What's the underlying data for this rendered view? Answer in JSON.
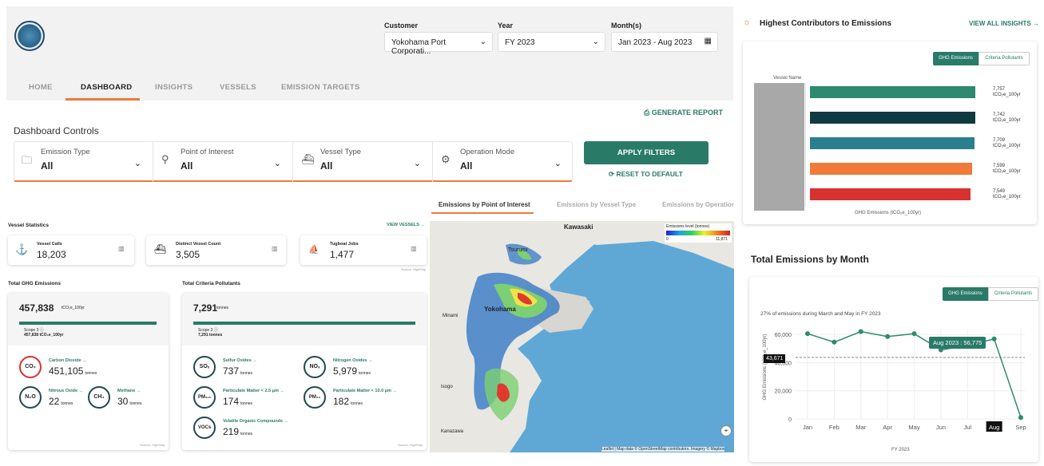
{
  "logo_text": "",
  "filters": {
    "customer_label": "Customer",
    "customer_value": "Yokohama Port Corporati...",
    "year_label": "Year",
    "year_value": "FY 2023",
    "month_label": "Month(s)",
    "month_value": "Jan 2023 - Aug 2023"
  },
  "nav": [
    "HOME",
    "DASHBOARD",
    "INSIGHTS",
    "VESSELS",
    "EMISSION TARGETS"
  ],
  "generate_report": "GENERATE REPORT",
  "dashboard_controls": "Dashboard Controls",
  "controls": [
    {
      "title": "Emission Type",
      "value": "All"
    },
    {
      "title": "Point of Interest",
      "value": "All"
    },
    {
      "title": "Vessel Type",
      "value": "All"
    },
    {
      "title": "Operation Mode",
      "value": "All"
    }
  ],
  "apply_filters": "APPLY FILTERS",
  "reset": "RESET TO DEFAULT",
  "map_tabs": [
    "Emissions by Point of Interest",
    "Emissions by Vessel Type",
    "Emissions by Operation"
  ],
  "map": {
    "legend_title": "Emissions level (tonnes)",
    "legend_min": "0",
    "legend_max": "11,871",
    "places": [
      "Tsurumi",
      "Kawasaki",
      "Yokohama",
      "Minami",
      "Isogo",
      "Kanazawa"
    ],
    "attribution": "Leaflet | Map data © OpenStreetMap contributors, Imagery © Mapbox"
  },
  "vessel_stats": {
    "title": "Vessel Statistics",
    "view_link": "VIEW VESSELS →",
    "items": [
      {
        "label": "Vessel Calls",
        "value": "18,203"
      },
      {
        "label": "Distinct Vessel Count",
        "value": "3,505"
      },
      {
        "label": "Tugboat Jobs",
        "value": "1,477"
      }
    ],
    "source": "Source: HighShip"
  },
  "ghg": {
    "title": "Total GHG Emissions",
    "total": "457,838",
    "unit": "tCO₂e_100yr",
    "scope_label": "Scope 3 ⓘ",
    "scope_value": "457,838 tCO₂e_100yr",
    "gases": [
      {
        "sym": "CO₂",
        "name": "Carbon Dioxide →",
        "value": "451,105",
        "unit": "tonnes"
      },
      {
        "sym": "N₂O",
        "name": "Nitrous Oxide →",
        "value": "22",
        "unit": "tonnes"
      },
      {
        "sym": "CH₄",
        "name": "Methane →",
        "value": "30",
        "unit": "tonnes"
      }
    ],
    "source": "Source: HighShip"
  },
  "criteria": {
    "title": "Total Criteria Pollutants",
    "total": "7,291",
    "unit": "tonnes",
    "scope_label": "Scope 3 ⓘ",
    "scope_value": "7,291 tonnes",
    "gases": [
      {
        "sym": "SOₓ",
        "name": "Sulfur Oxides →",
        "value": "737",
        "unit": "tonnes"
      },
      {
        "sym": "NOₓ",
        "name": "Nitrogen Oxides →",
        "value": "5,979",
        "unit": "tonnes"
      },
      {
        "sym": "PM₂.₅",
        "name": "Particulate Matter < 2.5 μm →",
        "value": "174",
        "unit": "tonnes"
      },
      {
        "sym": "PM₁₀",
        "name": "Particulate Matter < 10.0 μm →",
        "value": "182",
        "unit": "tonnes"
      },
      {
        "sym": "VOCs",
        "name": "Volatile Organic Compounds →",
        "value": "219",
        "unit": "tonnes"
      }
    ],
    "source": "Source: HighShip"
  },
  "contributors": {
    "title": "Highest Contributors to Emissions",
    "view_all": "VIEW ALL INSIGHTS →",
    "toggle": [
      "GHG Emissions",
      "Criteria Pollutants"
    ],
    "col_label": "Vessel Name",
    "xlabel": "GHG Emissions (tCO₂e_100yr)",
    "unit": "tCO₂e_100yr"
  },
  "monthly": {
    "title": "Total Emissions by Month",
    "toggle": [
      "GHG Emissions",
      "Criteria Pollutants"
    ],
    "subtitle": "27% of emissions during March and May in FY 2023",
    "ylabel": "GHG Emissions (tCO₂e_100yr)",
    "xlabel": "FY 2023",
    "tooltip": "Aug 2023 : 56,775",
    "crosshair_label": "43,671"
  },
  "chart_data": [
    {
      "type": "bar",
      "orientation": "horizontal",
      "categories": [
        "",
        "",
        "",
        "",
        ""
      ],
      "values": [
        7757,
        7742,
        7709,
        7599,
        7549
      ],
      "value_labels": [
        "7,757",
        "7,742",
        "7,709",
        "7,599",
        "7,549"
      ],
      "colors": [
        "#2d8a6e",
        "#0f3b40",
        "#2a7f8f",
        "#f07a3a",
        "#d9312f"
      ],
      "xlabel": "GHG Emissions (tCO₂e_100yr)"
    },
    {
      "type": "line",
      "x": [
        "Jan",
        "Feb",
        "Mar",
        "Apr",
        "May",
        "Jun",
        "Jul",
        "Aug",
        "Sep"
      ],
      "values": [
        60500,
        54500,
        62000,
        58500,
        60500,
        49000,
        52000,
        56775,
        1000
      ],
      "yticks": [
        "0",
        "20,000",
        "40,000",
        "60,000"
      ],
      "ylim": [
        0,
        64000
      ],
      "highlight": "Aug",
      "color": "#2d8a6e"
    }
  ]
}
